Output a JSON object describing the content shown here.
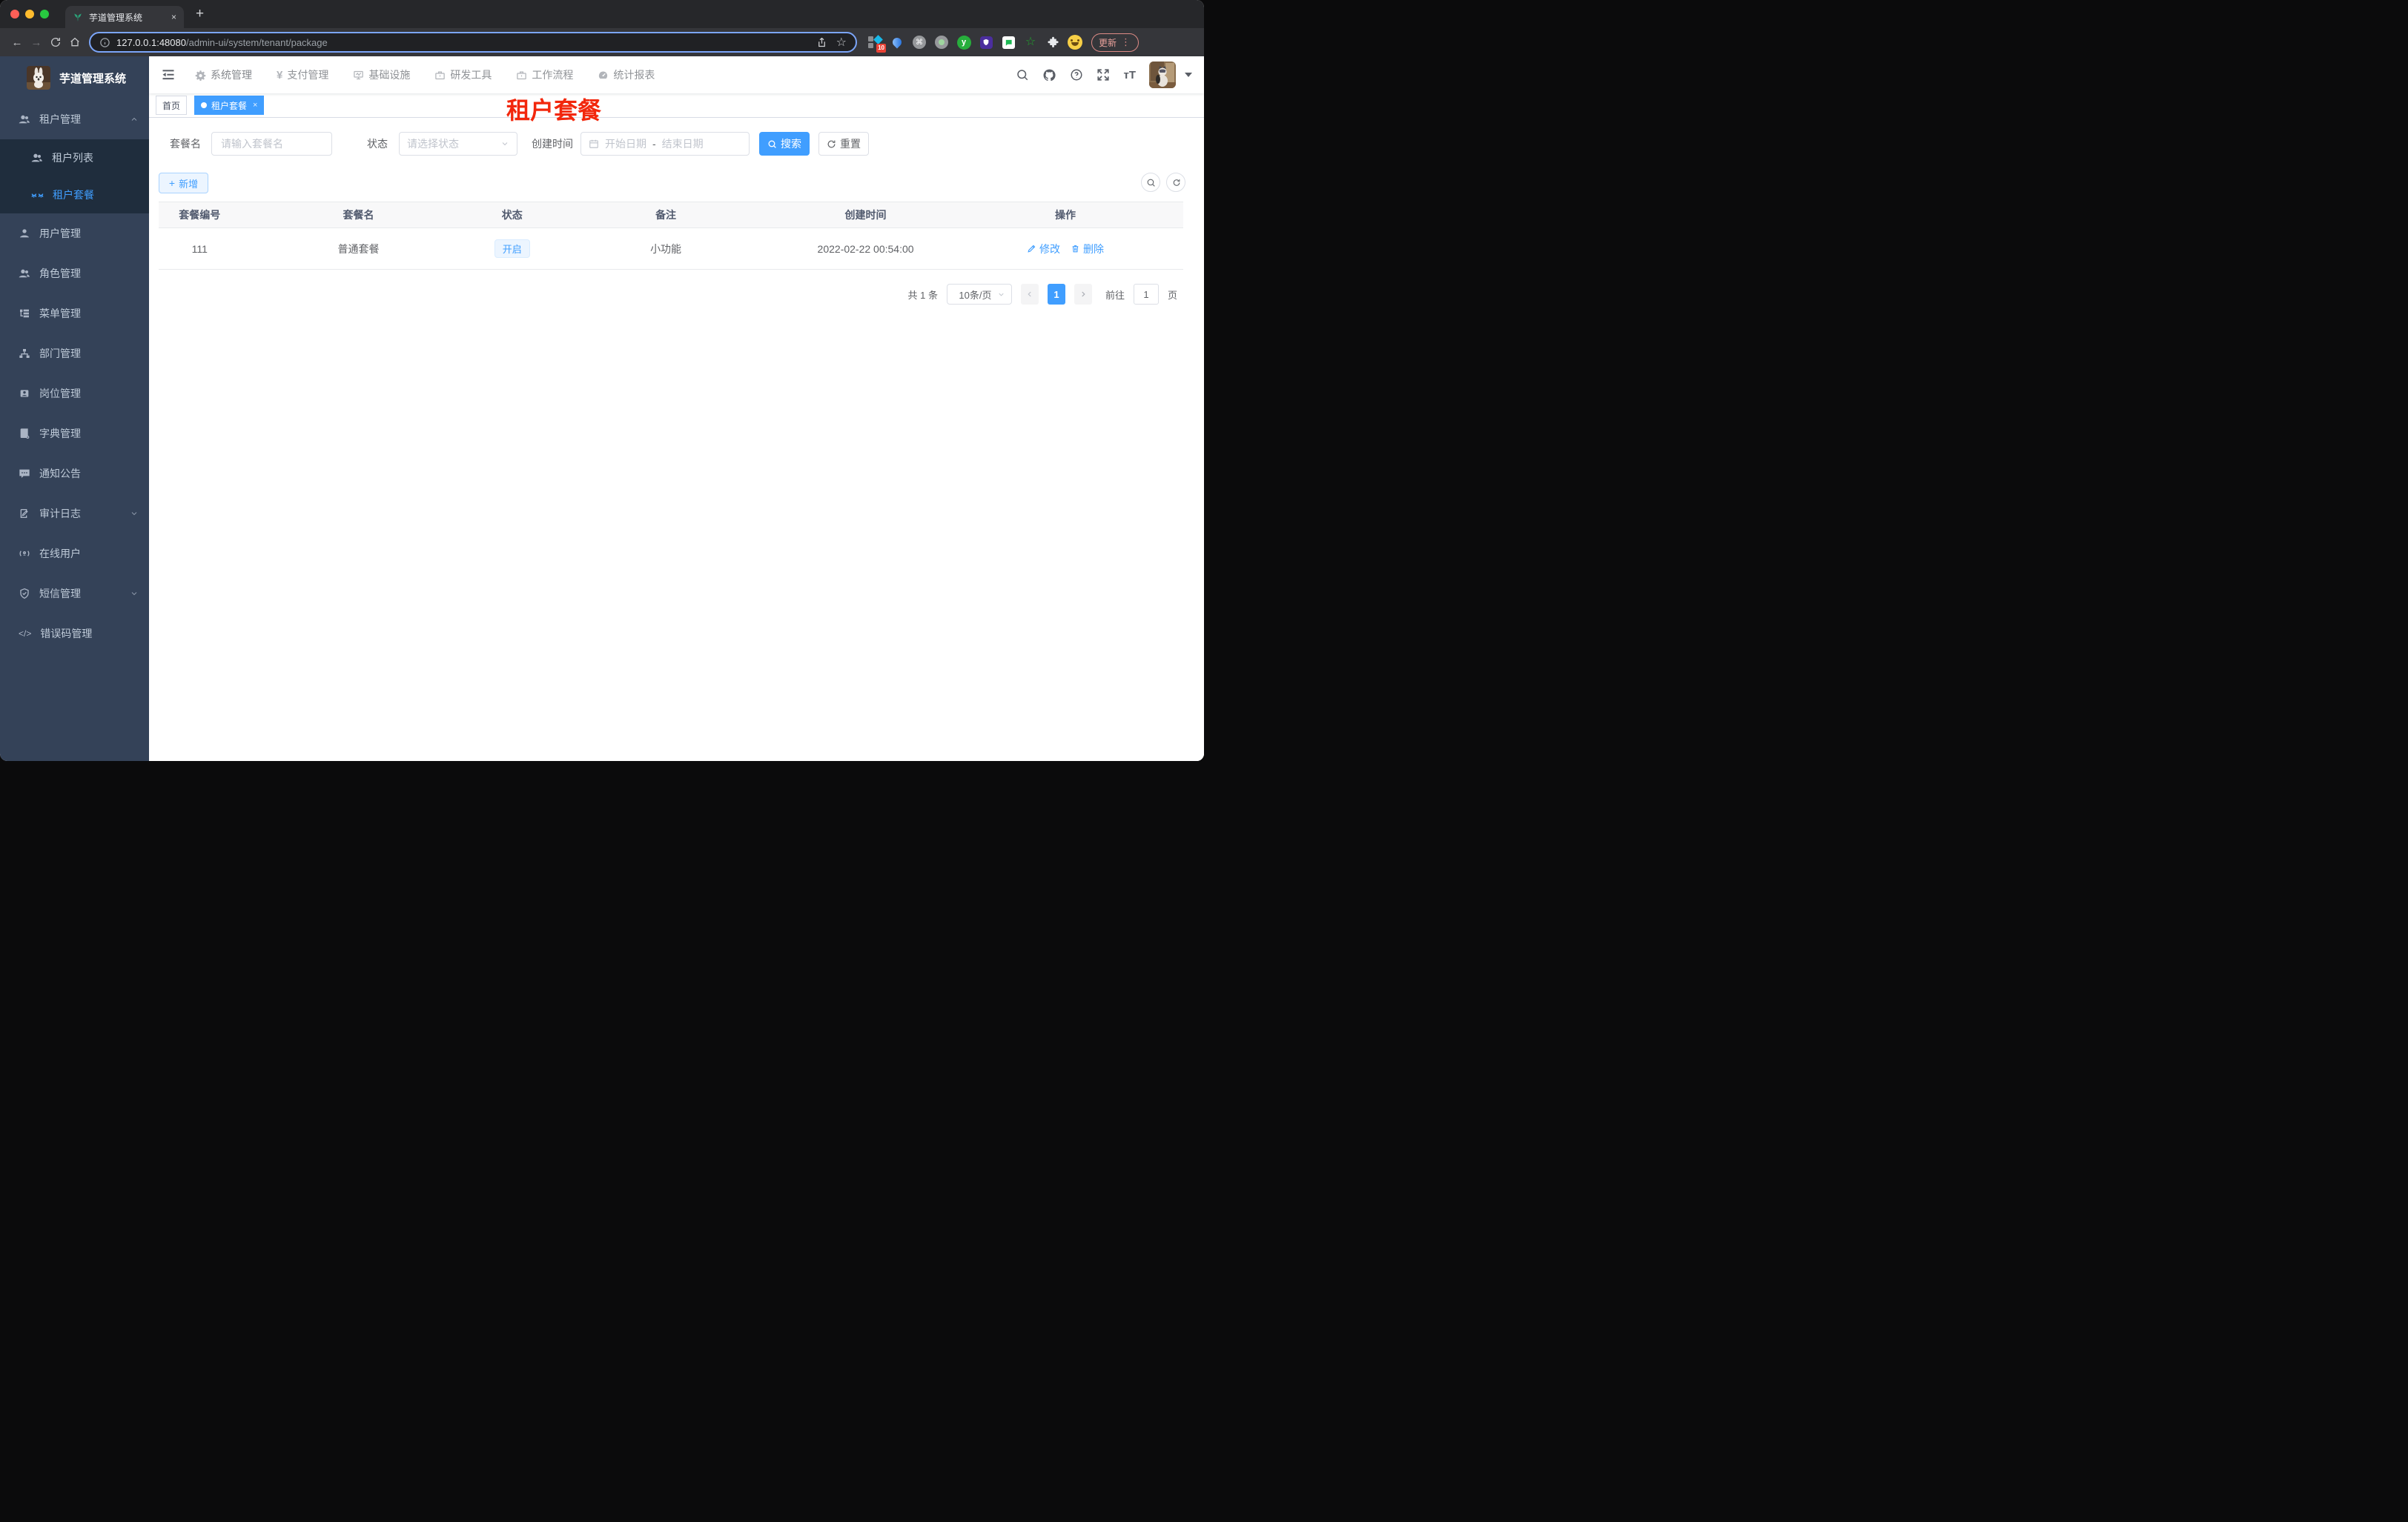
{
  "colors": {
    "accent": "#409eff",
    "sidebar_bg": "#344258",
    "submenu_bg": "#1f2d3d",
    "annotation_red": "#f2270c",
    "tag_plain_bg": "#ecf5ff",
    "traffic_red": "#ff5f57",
    "traffic_yellow": "#febc2e",
    "traffic_green": "#28c840"
  },
  "browser": {
    "tab_title": "芋道管理系统",
    "tab_close_glyph": "×",
    "new_tab_glyph": "+",
    "back_glyph": "←",
    "forward_glyph": "→",
    "url_host": "127.0.0.1:48080",
    "url_path": "/admin-ui/system/tenant/package",
    "star_glyph": "☆",
    "extension_badge": "10",
    "extension_y_label": "y",
    "command_glyph": "⌘",
    "update_label": "更新",
    "menu_dots_glyph": "⋮"
  },
  "sidebar": {
    "logo_title": "芋道管理系统",
    "items": [
      {
        "label": "租户管理"
      },
      {
        "label": "租户列表"
      },
      {
        "label": "租户套餐"
      },
      {
        "label": "用户管理"
      },
      {
        "label": "角色管理"
      },
      {
        "label": "菜单管理"
      },
      {
        "label": "部门管理"
      },
      {
        "label": "岗位管理"
      },
      {
        "label": "字典管理"
      },
      {
        "label": "通知公告"
      },
      {
        "label": "审计日志"
      },
      {
        "label": "在线用户"
      },
      {
        "label": "短信管理"
      },
      {
        "label": "错误码管理"
      }
    ]
  },
  "navbar": {
    "menus": [
      {
        "label": "系统管理"
      },
      {
        "label": "支付管理"
      },
      {
        "label": "基础设施"
      },
      {
        "label": "研发工具"
      },
      {
        "label": "工作流程"
      },
      {
        "label": "统计报表"
      }
    ],
    "font_size_glyph": "тT"
  },
  "tags_view": {
    "home_tab": "首页",
    "active_tab": "租户套餐",
    "close_glyph": "×"
  },
  "page": {
    "annotation_title": "租户套餐"
  },
  "filters": {
    "package_name_label": "套餐名",
    "package_name_placeholder": "请输入套餐名",
    "status_label": "状态",
    "status_placeholder": "请选择状态",
    "create_time_label": "创建时间",
    "date_start_placeholder": "开始日期",
    "date_separator": "-",
    "date_end_placeholder": "结束日期",
    "search_label": "搜索",
    "reset_label": "重置"
  },
  "toolbar": {
    "add_label": "新增",
    "plus_glyph": "+"
  },
  "table": {
    "columns": [
      "套餐编号",
      "套餐名",
      "状态",
      "备注",
      "创建时间",
      "操作"
    ],
    "rows": [
      {
        "id": "111",
        "name": "普通套餐",
        "status": "开启",
        "remark": "小功能",
        "create_time": "2022-02-22 00:54:00",
        "edit_label": "修改",
        "delete_label": "删除"
      }
    ]
  },
  "pagination": {
    "total_text": "共 1 条",
    "page_size": "10条/页",
    "current_page": "1",
    "goto_label": "前往",
    "goto_value": "1",
    "page_unit": "页"
  },
  "misc": {
    "code_glyph": "</>"
  }
}
